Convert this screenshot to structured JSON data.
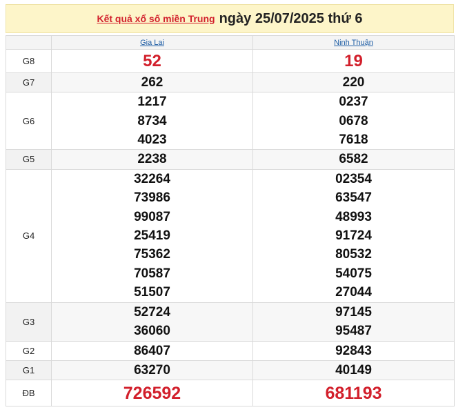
{
  "header": {
    "link_text": "Kết quả xổ số miền Trung",
    "date_text": "ngày 25/07/2025 thứ 6"
  },
  "provinces": [
    "Gia Lai",
    "Ninh Thuận"
  ],
  "prizes": [
    {
      "label": "G8",
      "values": [
        [
          "52"
        ],
        [
          "19"
        ]
      ]
    },
    {
      "label": "G7",
      "values": [
        [
          "262"
        ],
        [
          "220"
        ]
      ]
    },
    {
      "label": "G6",
      "values": [
        [
          "1217",
          "8734",
          "4023"
        ],
        [
          "0237",
          "0678",
          "7618"
        ]
      ]
    },
    {
      "label": "G5",
      "values": [
        [
          "2238"
        ],
        [
          "6582"
        ]
      ]
    },
    {
      "label": "G4",
      "values": [
        [
          "32264",
          "73986",
          "99087",
          "25419",
          "75362",
          "70587",
          "51507"
        ],
        [
          "02354",
          "63547",
          "48993",
          "91724",
          "80532",
          "54075",
          "27044"
        ]
      ]
    },
    {
      "label": "G3",
      "values": [
        [
          "52724",
          "36060"
        ],
        [
          "97145",
          "95487"
        ]
      ]
    },
    {
      "label": "G2",
      "values": [
        [
          "86407"
        ],
        [
          "92843"
        ]
      ]
    },
    {
      "label": "G1",
      "values": [
        [
          "63270"
        ],
        [
          "40149"
        ]
      ]
    },
    {
      "label": "ĐB",
      "values": [
        [
          "726592"
        ],
        [
          "681193"
        ]
      ]
    }
  ],
  "colors": {
    "header_bg": "#fdf5c9",
    "highlight_red": "#d21f2b",
    "province_link": "#1a5aa3",
    "shaded_row": "#f2f2f2"
  }
}
